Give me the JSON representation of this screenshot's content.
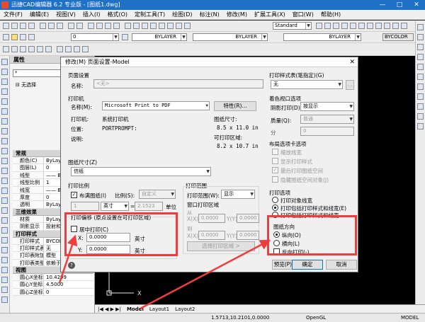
{
  "app": {
    "title": "迅捷CAD编辑器 6.2 专业版 - [图纸1.dwg]",
    "win_min": "—",
    "win_max": "□",
    "win_close": "✕"
  },
  "menu": [
    "文件(F)",
    "编辑(E)",
    "视图(V)",
    "插入(I)",
    "格式(O)",
    "定制工具(T)",
    "绘图(D)",
    "标注(N)",
    "修改(M)",
    "扩展工具(X)",
    "窗口(W)",
    "帮助(H)"
  ],
  "toolbar": {
    "style": "Standard",
    "layer": "0",
    "linetype1": "BYLAYER",
    "linetype2": "BYLAYER",
    "linetype3": "BYLAYER",
    "color": "BYCOLOR"
  },
  "props": {
    "title": "属性",
    "selector": "*",
    "tree_item": "无选择",
    "sections": [
      {
        "name": "常规",
        "rows": [
          [
            "颜色(C)",
            "ByLayer"
          ],
          [
            "图层(L)",
            "0"
          ],
          [
            "线型",
            "—— ByLayer"
          ],
          [
            "线型比例",
            "1"
          ],
          [
            "线宽",
            "—— ByLayer"
          ],
          [
            "厚度",
            "0"
          ],
          [
            "透明",
            "ByLayer"
          ]
        ]
      },
      {
        "name": "三维效果",
        "rows": [
          [
            "材质",
            "ByLayer"
          ],
          [
            "阴影显示",
            "投射和接收"
          ]
        ]
      },
      {
        "name": "打印样式",
        "rows": [
          [
            "打印样式",
            "BYCOLOR"
          ],
          [
            "打印样式表",
            "无"
          ],
          [
            "打印表附加到",
            "模型"
          ],
          [
            "打印表类型",
            "依赖于颜色"
          ]
        ]
      },
      {
        "name": "视图",
        "rows": [
          [
            "圆心X坐标",
            "10.4299"
          ],
          [
            "圆心Y坐标",
            "4.5000"
          ],
          [
            "圆心Z坐标",
            "0"
          ]
        ]
      }
    ]
  },
  "tabs": {
    "model": "Model",
    "layout1": "Layout1",
    "layout2": "Layout2"
  },
  "status": {
    "coords": "1.5713,10.2101,0.0000",
    "opengl": "OpenGL",
    "model": "MODEL"
  },
  "dialog": {
    "title": "修改(M) 页面设置-Model",
    "close": "✕",
    "page_setup": {
      "title": "页面设置",
      "name_label": "名称:",
      "name_value": "<无>"
    },
    "printer": {
      "title": "打印机",
      "name_label": "名称(M):",
      "name_value": "Microsoft Print to PDF",
      "prop_button": "特性(R)...",
      "printer_label": "打印机:",
      "printer_value": "系统打印机",
      "location_label": "位置:",
      "location_value": "PORTPROMPT:",
      "desc_label": "说明:",
      "size_label": "图纸尺寸:",
      "size_value": "8.5 x 11.0 in",
      "area_label": "可打印区域:",
      "area_value": "8.2 x 10.7 in"
    },
    "paper": {
      "title": "图纸尺寸(Z)",
      "value": "信纸"
    },
    "scale": {
      "title": "打印比例",
      "fit_label": "布满图纸(I)",
      "ratio_label": "比例(S):",
      "ratio_value": "自定义",
      "value1": "1",
      "unit": "英寸",
      "value2": "2.1523",
      "unit_label": "单位"
    },
    "offset": {
      "title": "打印偏移 (原点设置在可打印区域)",
      "center_label": "居中打印(C)",
      "x_label": "X:",
      "x_value": "0.0000",
      "x_unit": "英寸",
      "y_label": "Y:",
      "y_value": "0.0000",
      "y_unit": "英寸"
    },
    "range": {
      "title": "打印范围",
      "range_label": "打印范围(W):",
      "range_value": "显示",
      "window_label": "窗口打印区域",
      "from_label": "从",
      "to_label": "到",
      "x_label": "X(X)",
      "y_label": "Y(Y)",
      "from_x": "0.0000",
      "from_y": "0.0000",
      "to_x": "0.0000",
      "to_y": "0.0000",
      "select_button": "选择打印区域 >"
    },
    "style_table": {
      "title": "打印样式表(笔指定)(G)",
      "value": "无"
    },
    "shaded": {
      "title": "着色视口选项",
      "shade_label": "阴影打印(D)",
      "shade_value": "按显示",
      "quality_label": "质量(Q):",
      "quality_value": "普通",
      "dpi_label": "分",
      "dpi_value": "0"
    },
    "layout_opts": {
      "title": "布局选项卡选项",
      "items": [
        "缩放线宽",
        "显示打印样式",
        "最后打印图纸空间",
        "隐藏图纸空间对象(J)"
      ]
    },
    "print_opts": {
      "title": "打印选项",
      "items": [
        "打印对象线宽",
        "打印包括打印样式和线宽(E)",
        "打印包括打印样式和线宽"
      ]
    },
    "orientation": {
      "title": "图纸方向",
      "portrait": "纵向(O)",
      "landscape": "横向(L)",
      "reverse": "反向打印(-)"
    },
    "buttons": {
      "preview": "预览(P)...",
      "ok": "确定",
      "cancel": "取消"
    },
    "help_icon": "?"
  }
}
